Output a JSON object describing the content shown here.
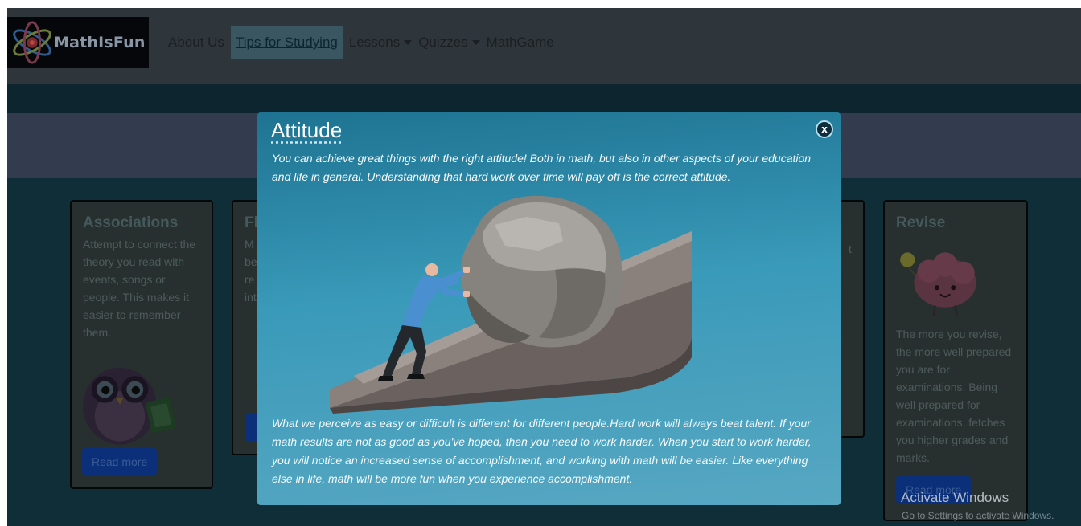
{
  "brand": {
    "name": "MathIsFun"
  },
  "nav": {
    "about": "About Us",
    "tips": "Tips for Studying",
    "lessons": "Lessons",
    "quizzes": "Quizzes",
    "game": "MathGame"
  },
  "cards": [
    {
      "title": "Associations",
      "text": "Attempt to connect the theory you read with events, songs or people. This makes it easier to remember them.",
      "button": "Read more"
    },
    {
      "title": "Fl",
      "text": "M be re int",
      "button": ""
    },
    {
      "title": "",
      "text": "t",
      "button": ""
    },
    {
      "title": "Revise",
      "text": "The more you revise, the more well prepared you are for examinations. Being well prepared for examinations, fetches you higher grades and marks.",
      "button": "Read more"
    }
  ],
  "modal": {
    "title": "Attitude",
    "close": "x",
    "intro": "You can achieve great things with the right attitude! Both in math, but also in other aspects of your education and life in general. Understanding that hard work over time will pay off is the correct attitude.",
    "body": "What we perceive as easy or difficult is different for different people.Hard work will always beat talent. If your math results are not as good as you've hoped, then you need to work harder. When you start to work harder, you will notice an increased sense of accomplishment, and working with math will be easier. Like everything else in life, math will be more fun when you experience accomplishment."
  },
  "watermark": {
    "title": "Activate Windows",
    "subtitle": "Go to Settings to activate Windows."
  },
  "icons": {
    "logo": "atom-icon",
    "close": "close-icon",
    "dropdown": "caret-down-icon",
    "owl": "owl-illustration",
    "brain": "brain-illustration",
    "boulder": "man-pushing-boulder-illustration"
  },
  "colors": {
    "navbar": "#2f363b",
    "modal": "#2a86a6",
    "button": "#0b2f78"
  }
}
